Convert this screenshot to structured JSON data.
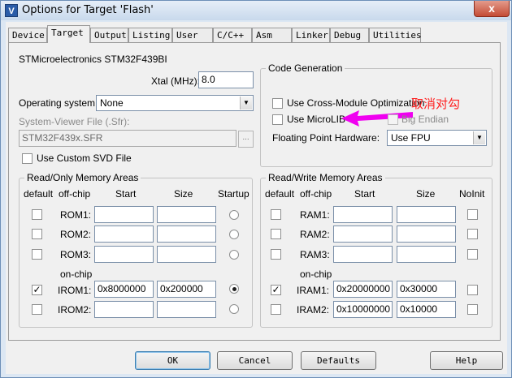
{
  "window": {
    "title": "Options for Target 'Flash'",
    "app_icon_glyph": "V",
    "close_glyph": "x"
  },
  "tabs": [
    {
      "label": "Device",
      "active": false
    },
    {
      "label": "Target",
      "active": true
    },
    {
      "label": "Output",
      "active": false
    },
    {
      "label": "Listing",
      "active": false
    },
    {
      "label": "User",
      "active": false
    },
    {
      "label": "C/C++",
      "active": false
    },
    {
      "label": "Asm",
      "active": false
    },
    {
      "label": "Linker",
      "active": false
    },
    {
      "label": "Debug",
      "active": false
    },
    {
      "label": "Utilities",
      "active": false
    }
  ],
  "device": {
    "name": "STMicroelectronics STM32F439BI",
    "xtal_label": "Xtal (MHz):",
    "xtal_value": "8.0",
    "os_label": "Operating system:",
    "os_value": "None",
    "svd_label": "System-Viewer File (.Sfr):",
    "svd_value": "STM32F439x.SFR",
    "browse_label": "...",
    "custom_svd_label": "Use Custom SVD File"
  },
  "code_generation": {
    "title": "Code Generation",
    "cross_module_label": "Use Cross-Module Optimization",
    "microlib_label": "Use MicroLIB",
    "big_endian_label": "Big Endian",
    "fpu_label": "Floating Point Hardware:",
    "fpu_value": "Use FPU",
    "annotation": "取消对勾"
  },
  "rom": {
    "title": "Read/Only Memory Areas",
    "headers": {
      "default": "default",
      "offchip": "off-chip",
      "start": "Start",
      "size": "Size",
      "extra": "Startup"
    },
    "onchip_label": "on-chip",
    "rows": [
      {
        "label": "ROM1:",
        "start": "",
        "size": "",
        "default": false,
        "selected": false
      },
      {
        "label": "ROM2:",
        "start": "",
        "size": "",
        "default": false,
        "selected": false
      },
      {
        "label": "ROM3:",
        "start": "",
        "size": "",
        "default": false,
        "selected": false
      },
      {
        "label": "IROM1:",
        "start": "0x8000000",
        "size": "0x200000",
        "default": true,
        "selected": true
      },
      {
        "label": "IROM2:",
        "start": "",
        "size": "",
        "default": false,
        "selected": false
      }
    ]
  },
  "ram": {
    "title": "Read/Write Memory Areas",
    "headers": {
      "default": "default",
      "offchip": "off-chip",
      "start": "Start",
      "size": "Size",
      "extra": "NoInit"
    },
    "onchip_label": "on-chip",
    "rows": [
      {
        "label": "RAM1:",
        "start": "",
        "size": "",
        "default": false,
        "noinit": false
      },
      {
        "label": "RAM2:",
        "start": "",
        "size": "",
        "default": false,
        "noinit": false
      },
      {
        "label": "RAM3:",
        "start": "",
        "size": "",
        "default": false,
        "noinit": false
      },
      {
        "label": "IRAM1:",
        "start": "0x20000000",
        "size": "0x30000",
        "default": true,
        "noinit": false
      },
      {
        "label": "IRAM2:",
        "start": "0x10000000",
        "size": "0x10000",
        "default": false,
        "noinit": false
      }
    ]
  },
  "buttons": {
    "ok": "OK",
    "cancel": "Cancel",
    "defaults": "Defaults",
    "help": "Help"
  },
  "colors": {
    "annotation": "#ff2020",
    "arrow": "#f000f0"
  }
}
